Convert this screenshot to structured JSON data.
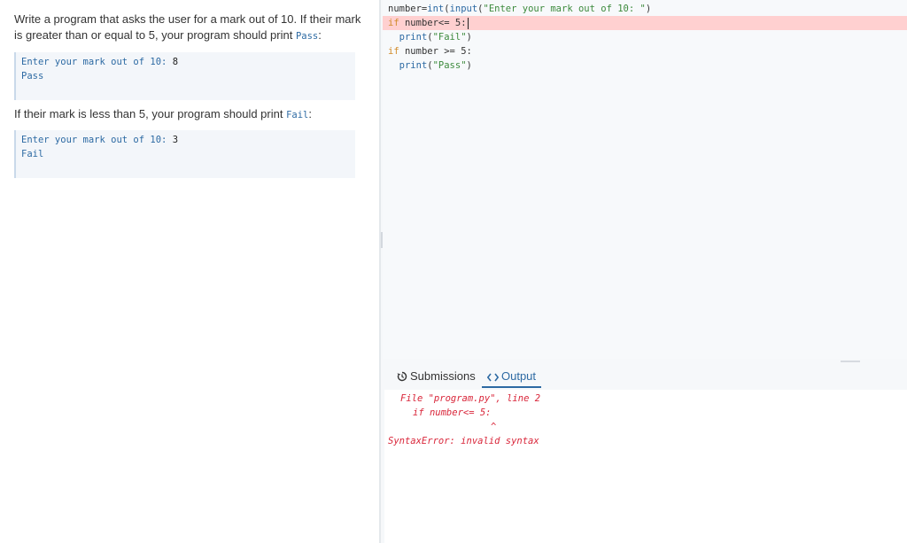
{
  "instructions": {
    "para1_text": "Write a program that asks the user for a mark out of 10. If their mark is greater than or equal to 5, your program should print ",
    "para1_code": "Pass",
    "para1_end": ":",
    "example1": {
      "prompt": "Enter your mark out of 10: ",
      "value": "8",
      "output": "Pass"
    },
    "para2_text": "If their mark is less than 5, your program should print ",
    "para2_code": "Fail",
    "para2_end": ":",
    "example2": {
      "prompt": "Enter your mark out of 10: ",
      "value": "3",
      "output": "Fail"
    }
  },
  "editor": {
    "line1": {
      "var": "number=",
      "fn1": "int",
      "p1": "(",
      "fn2": "input",
      "p2": "(",
      "str": "\"Enter your mark out of 10: \"",
      "p3": ")"
    },
    "line2": {
      "kw": "if",
      "rest": " number<= 5:"
    },
    "line3": {
      "indent": "  ",
      "fn": "print",
      "p1": "(",
      "str": "\"Fail\"",
      "p2": ")"
    },
    "line4": {
      "kw": "if",
      "rest": " number >= 5:"
    },
    "line5": {
      "indent": "  ",
      "fn": "print",
      "p1": "(",
      "str": "\"Pass\"",
      "p2": ")"
    }
  },
  "tabs": {
    "submissions_label": "Submissions",
    "output_label": "Output",
    "active": "Output"
  },
  "output": {
    "line1": "File \"program.py\", line 2",
    "line2": "if number<= 5:",
    "line3": "^",
    "line4": "SyntaxError: invalid syntax"
  },
  "colors": {
    "accent": "#2d6aa3",
    "error": "#d9263a",
    "error_line_bg": "#ffd0d0",
    "keyword": "#d28c2d",
    "string": "#3c8a3c"
  },
  "icons": {
    "submissions": "history-icon",
    "output": "code-brackets-icon"
  }
}
